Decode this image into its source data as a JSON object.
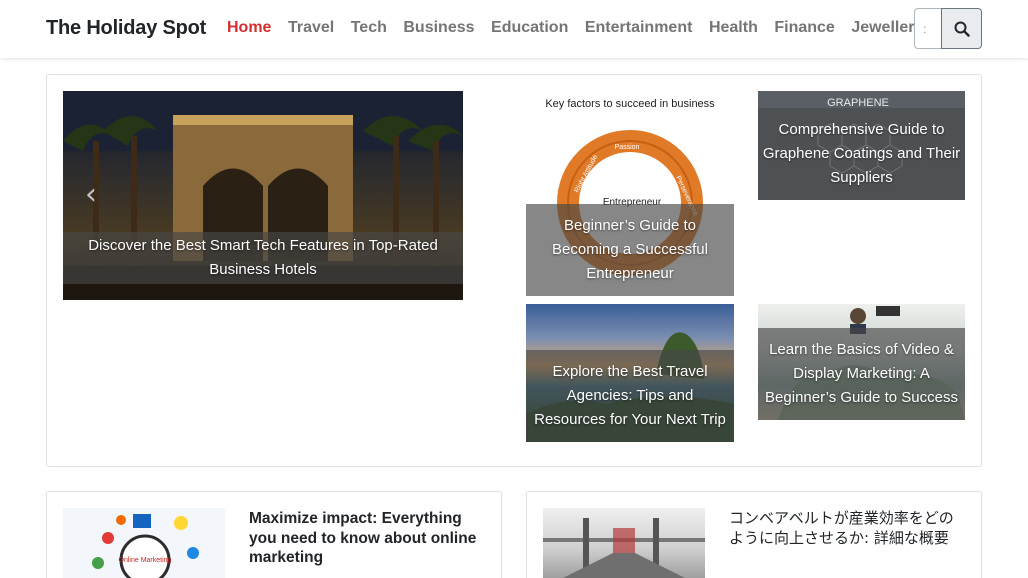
{
  "header": {
    "brand": "The Holiday Spot",
    "nav": [
      "Home",
      "Travel",
      "Tech",
      "Business",
      "Education",
      "Entertainment",
      "Health",
      "Finance",
      "Jewellery"
    ],
    "active_nav": "Home",
    "search": {
      "value": ":",
      "placeholder": "",
      "icon": "search-icon"
    }
  },
  "featured": {
    "hero": {
      "title": "Discover the Best Smart Tech Features in Top-Rated Business Hotels",
      "arrow": "‹"
    },
    "cards": [
      {
        "title": "Beginner’s Guide to Becoming a Successful Entrepreneur",
        "image_text": {
          "heading": "Key factors to succeed in business",
          "center": "Entrepreneur",
          "top": "Passion",
          "left": "Right Attitude",
          "right": "Perseverance"
        }
      },
      {
        "title": "Comprehensive Guide to Graphene Coatings and Their Suppliers",
        "image_text": {
          "heading": "GRAPHENE"
        }
      },
      {
        "title": "Explore the Best Travel Agencies: Tips and Resources for Your Next Trip"
      },
      {
        "title": "Learn the Basics of Video & Display Marketing: A Beginner’s Guide to Success"
      }
    ]
  },
  "posts": [
    {
      "title": "Maximize impact: Everything you need to know about online marketing",
      "image_text": "Online Marketing"
    },
    {
      "title": "コンベアベルトが産業効率をどのように向上させるか: 詳細な概要"
    }
  ],
  "colors": {
    "accent": "#d32f2f",
    "nav_text": "#757575",
    "caption_bg": "#464646",
    "arrow_orange": "#e07a27"
  }
}
